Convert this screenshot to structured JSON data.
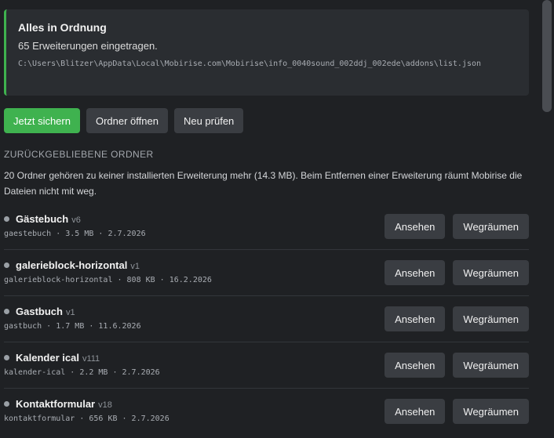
{
  "status": {
    "title": "Alles in Ordnung",
    "count_text": "65 Erweiterungen eingetragen.",
    "path": "C:\\Users\\Blitzer\\AppData\\Local\\Mobirise.com\\Mobirise\\info_0040sound_002ddj_002ede\\addons\\list.json"
  },
  "actions": {
    "save_label": "Jetzt sichern",
    "open_folder_label": "Ordner öffnen",
    "recheck_label": "Neu prüfen"
  },
  "orphans": {
    "heading": "ZURÜCKGEBLIEBENE ORDNER",
    "description": "20 Ordner gehören zu keiner installierten Erweiterung mehr (14.3 MB). Beim Entfernen einer Erweiterung räumt Mobirise die Dateien nicht mit weg.",
    "view_label": "Ansehen",
    "remove_label": "Wegräumen",
    "items": [
      {
        "name": "Gästebuch",
        "version": "v6",
        "meta": "gaestebuch · 3.5 MB · 2.7.2026"
      },
      {
        "name": "galerieblock-horizontal",
        "version": "v1",
        "meta": "galerieblock-horizontal · 808 KB · 16.2.2026"
      },
      {
        "name": "Gastbuch",
        "version": "v1",
        "meta": "gastbuch · 1.7 MB · 11.6.2026"
      },
      {
        "name": "Kalender ical",
        "version": "v111",
        "meta": "kalender-ical · 2.2 MB · 2.7.2026"
      },
      {
        "name": "Kontaktformular",
        "version": "v18",
        "meta": "kontaktformular · 656 KB · 2.7.2026"
      }
    ]
  },
  "colors": {
    "accent": "#3fb24f",
    "background": "#1f2124",
    "panel": "#2a2d31",
    "button": "#3a3d42"
  }
}
